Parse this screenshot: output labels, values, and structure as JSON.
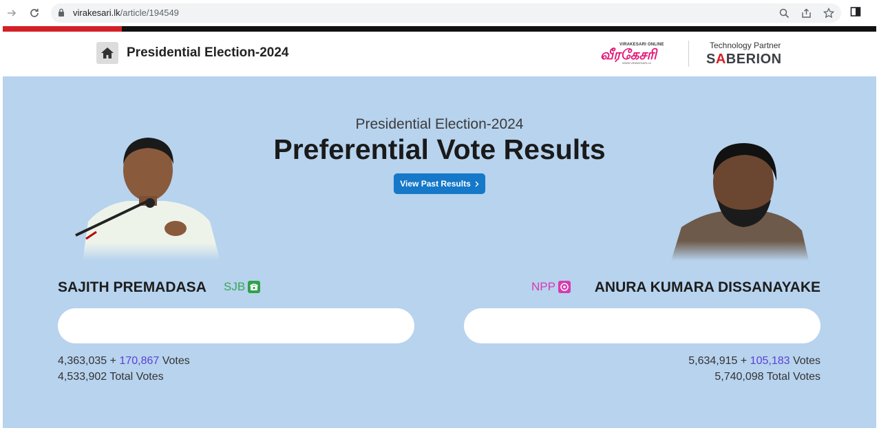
{
  "browser": {
    "url_host": "virakesari.lk",
    "url_path": "/article/194549"
  },
  "header": {
    "title": "Presidential Election-2024",
    "partner_label": "Technology Partner",
    "partner_name_pre": "S",
    "partner_name_accent": "A",
    "partner_name_post": "BERION",
    "brand_small": "VIRAKESARI ONLINE",
    "brand_big": "வீரகேசரி",
    "brand_url": "WWW.VIRAKESARI.LK"
  },
  "hero": {
    "subtitle": "Presidential Election-2024",
    "title": "Preferential Vote Results",
    "past_button": "View Past Results"
  },
  "candidates": [
    {
      "name": "SAJITH PREMADASA",
      "party": "SJB",
      "party_color": "#3aa655",
      "base_votes": "4,363,035",
      "plus": "+",
      "pref_votes": "170,867",
      "votes_label": "Votes",
      "total_votes": "4,533,902",
      "total_label": "Total Votes"
    },
    {
      "name": "ANURA KUMARA DISSANAYAKE",
      "party": "NPP",
      "party_color": "#d63bb0",
      "base_votes": "5,634,915",
      "plus": "+",
      "pref_votes": "105,183",
      "votes_label": "Votes",
      "total_votes": "5,740,098",
      "total_label": "Total Votes"
    }
  ],
  "colors": {
    "panel_bg": "#b7d3ee",
    "accent_blue": "#1578c8",
    "pref_purple": "#5b3fd8",
    "topbar_red": "#d32027"
  }
}
